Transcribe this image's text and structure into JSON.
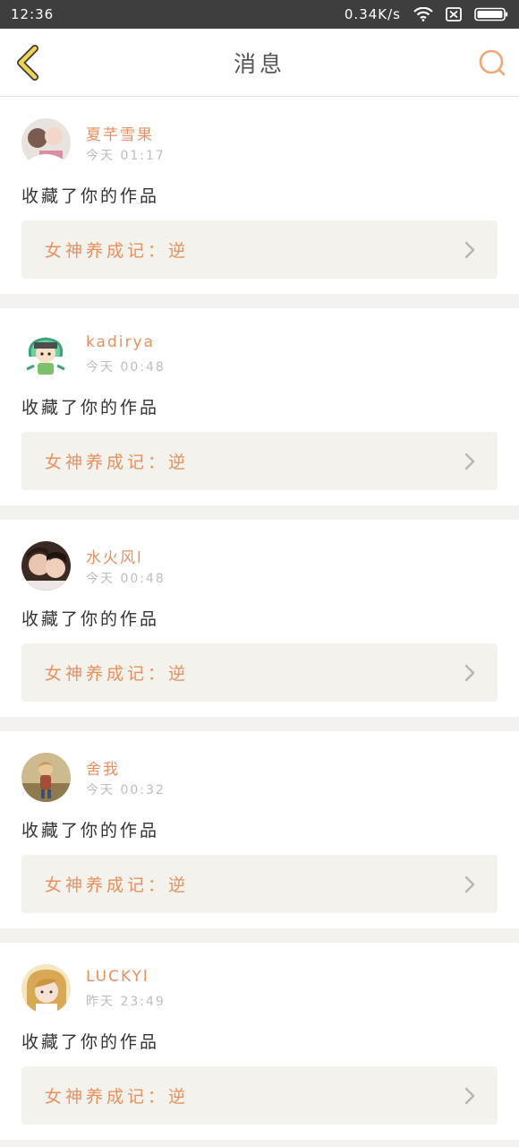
{
  "status_bar": {
    "time": "12:36",
    "network_speed": "0.34K/s",
    "icons": [
      "wifi-icon",
      "no-sim-icon",
      "battery-icon"
    ]
  },
  "header": {
    "title": "消息",
    "back_icon": "chevron-left-icon",
    "search_icon": "search-icon"
  },
  "colors": {
    "accent": "#e8905e",
    "back_arrow": "#f2d34c",
    "status_bar_bg": "#3e3e3e",
    "page_bg": "#f3f2ef",
    "work_box_bg": "#f3f2ec"
  },
  "messages": [
    {
      "username": "夏芊雪果",
      "time": "今天 01:17",
      "action": "收藏了你的作品",
      "work_title": "女神养成记：逆"
    },
    {
      "username": "kadirya",
      "time": "今天 00:48",
      "action": "收藏了你的作品",
      "work_title": "女神养成记：逆"
    },
    {
      "username": "水火风l",
      "time": "今天 00:48",
      "action": "收藏了你的作品",
      "work_title": "女神养成记：逆"
    },
    {
      "username": "舍我",
      "time": "今天 00:32",
      "action": "收藏了你的作品",
      "work_title": "女神养成记：逆"
    },
    {
      "username": "LUCKYl",
      "time": "昨天 23:49",
      "action": "收藏了你的作品",
      "work_title": "女神养成记：逆"
    }
  ]
}
